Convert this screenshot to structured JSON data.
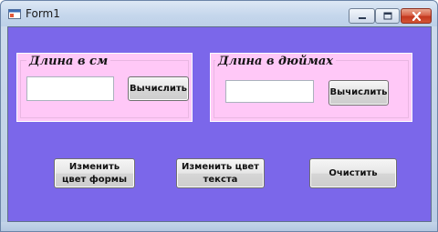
{
  "window": {
    "title": "Form1",
    "controls": {
      "minimize_icon": "minimize-icon",
      "maximize_icon": "maximize-icon",
      "close_icon": "close-icon"
    }
  },
  "colors": {
    "form_background": "#7b67ea",
    "group_background": "#ffc8f7",
    "close_button": "#c3391f"
  },
  "groups": {
    "cm": {
      "title": "Длина в см",
      "input_value": "",
      "button_label": "Вычислить"
    },
    "inches": {
      "title": "Длина в дюймах",
      "input_value": "",
      "button_label": "Вычислить"
    }
  },
  "actions": {
    "change_form_color": "Изменить цвет формы",
    "change_text_color": "Изменить цвет текста",
    "clear": "Очистить"
  }
}
